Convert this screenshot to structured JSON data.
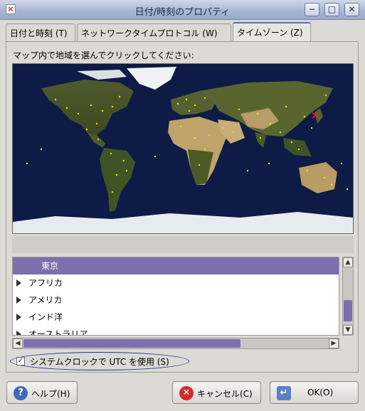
{
  "window": {
    "title": "日付/時刻のプロパティ",
    "minimize_glyph": "−",
    "maximize_glyph": "□",
    "close_glyph": "✕"
  },
  "tabs": [
    {
      "label": "日付と時刻 (T)",
      "active": false
    },
    {
      "label": "ネットワークタイムプロトコル (W)",
      "active": false
    },
    {
      "label": "タイムゾーン (Z)",
      "active": true
    }
  ],
  "timezone": {
    "prompt": "マップ内で地域を選んでクリックしてください:",
    "selected_city": "東京",
    "regions": [
      "アフリカ",
      "アメリカ",
      "インド洋",
      "オーストラリア"
    ],
    "utc_checkbox": {
      "label": "システムクロックで UTC を使用 (S)",
      "checked": true
    }
  },
  "buttons": {
    "help": "ヘルプ(H)",
    "cancel": "キャンセル(C)",
    "ok": "OK(O)"
  },
  "icons": {
    "app": "app-icon",
    "help": "help-icon",
    "cancel": "cancel-icon",
    "ok": "ok-arrow-icon"
  },
  "colors": {
    "selection": "#7c6fae",
    "ocean": "#0d1b46",
    "city_dot": "#e6e600",
    "selected_marker": "#ff2020"
  }
}
